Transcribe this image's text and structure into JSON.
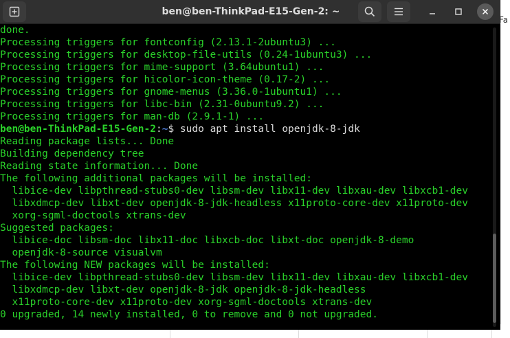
{
  "window": {
    "title": "ben@ben-ThinkPad-E15-Gen-2: ~"
  },
  "background_app": {
    "partial_text": "Fa"
  },
  "terminal": {
    "lines_before": [
      "done.",
      "Processing triggers for fontconfig (2.13.1-2ubuntu3) ...",
      "Processing triggers for desktop-file-utils (0.24-1ubuntu3) ...",
      "Processing triggers for mime-support (3.64ubuntu1) ...",
      "Processing triggers for hicolor-icon-theme (0.17-2) ...",
      "Processing triggers for gnome-menus (3.36.0-1ubuntu1) ...",
      "Processing triggers for libc-bin (2.31-0ubuntu9.2) ...",
      "Processing triggers for man-db (2.9.1-1) ..."
    ],
    "prompt": {
      "user_host": "ben@ben-ThinkPad-E15-Gen-2",
      "separator": ":",
      "path": "~",
      "sign": "$",
      "command": " sudo apt install openjdk-8-jdk"
    },
    "lines_after": [
      "Reading package lists... Done",
      "Building dependency tree",
      "Reading state information... Done",
      "The following additional packages will be installed:",
      "  libice-dev libpthread-stubs0-dev libsm-dev libx11-dev libxau-dev libxcb1-dev",
      "  libxdmcp-dev libxt-dev openjdk-8-jdk-headless x11proto-core-dev x11proto-dev",
      "  xorg-sgml-doctools xtrans-dev",
      "Suggested packages:",
      "  libice-doc libsm-doc libx11-doc libxcb-doc libxt-doc openjdk-8-demo",
      "  openjdk-8-source visualvm",
      "The following NEW packages will be installed:",
      "  libice-dev libpthread-stubs0-dev libsm-dev libx11-dev libxau-dev libxcb1-dev",
      "  libxdmcp-dev libxt-dev openjdk-8-jdk openjdk-8-jdk-headless",
      "  x11proto-core-dev x11proto-dev xorg-sgml-doctools xtrans-dev",
      "0 upgraded, 14 newly installed, 0 to remove and 0 not upgraded."
    ]
  },
  "icons": {
    "new_tab": "new-tab-icon",
    "search": "search-icon",
    "menu": "hamburger-menu-icon",
    "minimize": "minimize-icon",
    "maximize": "maximize-icon",
    "close": "close-icon"
  },
  "colors": {
    "terminal_bg": "#000000",
    "terminal_text": "#2ad12a",
    "prompt_path": "#4f7bd6",
    "titlebar_bg": "#303030",
    "close_button_bg": "#5a5a5a"
  }
}
